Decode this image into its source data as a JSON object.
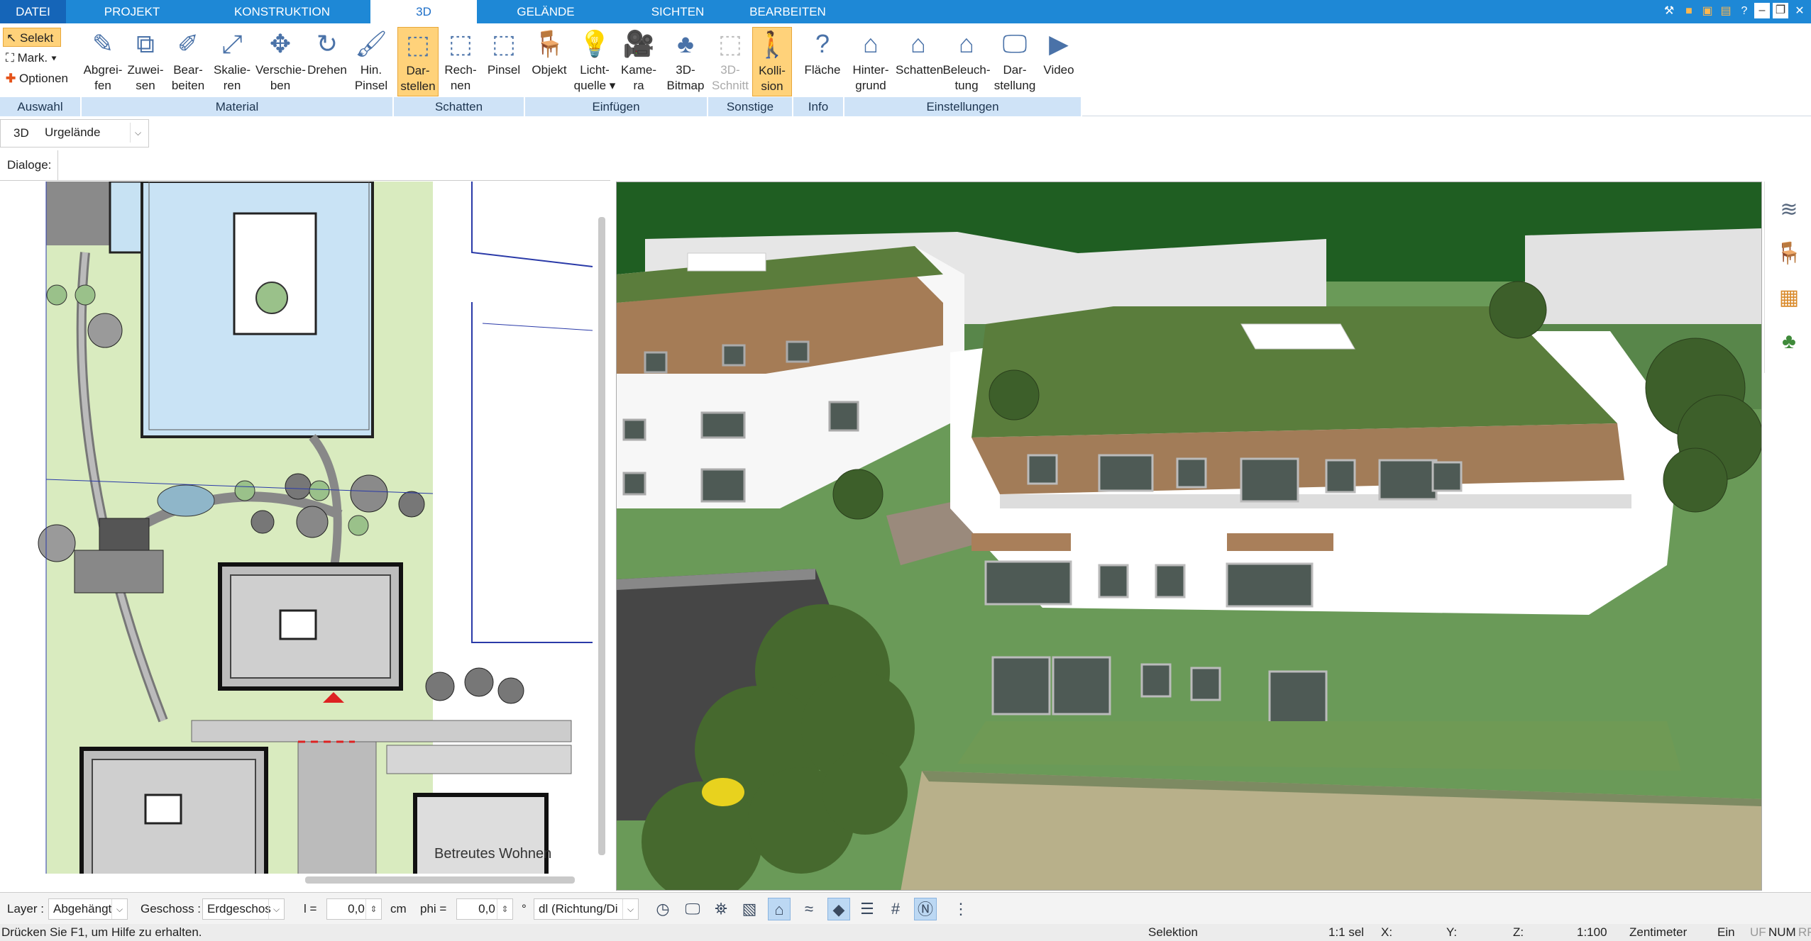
{
  "menu": {
    "tabs": [
      "DATEI",
      "PROJEKT",
      "KONSTRUKTION",
      "3D",
      "GELÄNDE",
      "SICHTEN",
      "BEARBEITEN"
    ]
  },
  "ribbon": {
    "auswahl": {
      "selekt": "Selekt",
      "mark": "Mark.",
      "optionen": "Optionen",
      "label": "Auswahl"
    },
    "material": {
      "label": "Material",
      "buttons": [
        {
          "l1": "Abgrei-",
          "l2": "fen",
          "icon": "eyedropper-icon"
        },
        {
          "l1": "Zuwei-",
          "l2": "sen",
          "icon": "assign-material-icon"
        },
        {
          "l1": "Bear-",
          "l2": "beiten",
          "icon": "edit-material-icon"
        },
        {
          "l1": "Skalie-",
          "l2": "ren",
          "icon": "scale-icon"
        },
        {
          "l1": "Verschie-",
          "l2": "ben",
          "icon": "move-icon"
        },
        {
          "l1": "Drehen",
          "l2": "",
          "icon": "rotate-icon"
        },
        {
          "l1": "Hin.",
          "l2": "Pinsel",
          "icon": "brush-icon"
        }
      ]
    },
    "schatten": {
      "label": "Schatten",
      "buttons": [
        {
          "l1": "Dar-",
          "l2": "stellen",
          "icon": "cube-icon"
        },
        {
          "l1": "Rech-",
          "l2": "nen",
          "icon": "calc-cube-icon"
        },
        {
          "l1": "Pinsel",
          "l2": "",
          "icon": "paint-cube-icon"
        }
      ]
    },
    "einfuegen": {
      "label": "Einfügen",
      "buttons": [
        {
          "l1": "Objekt",
          "l2": "",
          "icon": "chair-icon"
        },
        {
          "l1": "Licht-",
          "l2": "quelle ▾",
          "icon": "lightbulb-icon"
        },
        {
          "l1": "Kame-",
          "l2": "ra",
          "icon": "camera-icon"
        },
        {
          "l1": "3D-",
          "l2": "Bitmap",
          "icon": "tree-icon"
        }
      ]
    },
    "sonstige": {
      "label": "Sonstige",
      "buttons": [
        {
          "l1": "3D-",
          "l2": "Schnitt",
          "icon": "section-icon"
        },
        {
          "l1": "Kolli-",
          "l2": "sion",
          "icon": "collision-person-icon"
        }
      ]
    },
    "info": {
      "label": "Info",
      "buttons": [
        {
          "l1": "Fläche",
          "l2": "",
          "icon": "area-info-icon"
        }
      ]
    },
    "einstellungen": {
      "label": "Einstellungen",
      "buttons": [
        {
          "l1": "Hinter-",
          "l2": "grund",
          "icon": "background-house-icon"
        },
        {
          "l1": "Schatten",
          "l2": "",
          "icon": "shadow-house-icon"
        },
        {
          "l1": "Beleuch-",
          "l2": "tung",
          "icon": "lighting-house-icon"
        },
        {
          "l1": "Dar-",
          "l2": "stellung",
          "icon": "monitor-icon"
        },
        {
          "l1": "Video",
          "l2": "",
          "icon": "play-icon"
        }
      ]
    }
  },
  "optrow": {
    "mode": "3D",
    "terrain": "Urgelände"
  },
  "dialoge": "Dialoge:",
  "plan": {
    "building_label": "Betreutes Wohnen"
  },
  "bottom": {
    "layer_label": "Layer :",
    "layer_value": "Abgehängt",
    "geschoss_label": "Geschoss :",
    "geschoss_value": "Erdgeschos",
    "l_label": "l =",
    "l_value": "0,0",
    "l_unit": "cm",
    "phi_label": "phi =",
    "phi_value": "0,0",
    "phi_unit": "°",
    "dl_value": "dl (Richtung/Di"
  },
  "status": {
    "help": "Drücken Sie F1, um Hilfe zu erhalten.",
    "mode": "Selektion",
    "ratio": "1:1 sel",
    "x": "X:",
    "y": "Y:",
    "z": "Z:",
    "scale": "1:100",
    "unit": "Zentimeter",
    "ein": "Ein",
    "uf": "UF",
    "num": "NUM",
    "rf": "RF"
  },
  "colors": {
    "accent": "#1e88d6",
    "selected": "#ffd27a",
    "group_label": "#cfe3f7"
  }
}
